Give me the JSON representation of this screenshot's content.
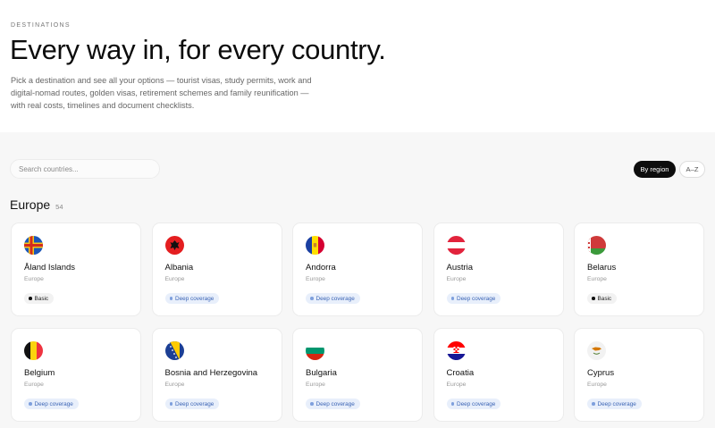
{
  "hero": {
    "eyebrow": "DESTINATIONS",
    "title": "Every way in, for every country.",
    "lead": "Pick a destination and see all your options — tourist visas, study permits, work and digital-nomad routes, golden visas, retirement schemes and family reunification — with real costs, timelines and document checklists."
  },
  "search": {
    "placeholder": "Search countries..."
  },
  "view_toggle": {
    "active_label": "By region",
    "alt_label": "A–Z"
  },
  "region": {
    "name": "Europe",
    "count": "54"
  },
  "badges": {
    "deep": "Deep coverage",
    "basic": "Basic"
  },
  "countries": [
    {
      "name": "Åland Islands",
      "region": "Europe",
      "badge": "Basic",
      "flag": "aland-flag-icon"
    },
    {
      "name": "Albania",
      "region": "Europe",
      "badge": "Deep coverage",
      "flag": "albania-flag-icon"
    },
    {
      "name": "Andorra",
      "region": "Europe",
      "badge": "Deep coverage",
      "flag": "andorra-flag-icon"
    },
    {
      "name": "Austria",
      "region": "Europe",
      "badge": "Deep coverage",
      "flag": "austria-flag-icon"
    },
    {
      "name": "Belarus",
      "region": "Europe",
      "badge": "Basic",
      "flag": "belarus-flag-icon"
    },
    {
      "name": "Belgium",
      "region": "Europe",
      "badge": "Deep coverage",
      "flag": "belgium-flag-icon"
    },
    {
      "name": "Bosnia and Herzegovina",
      "region": "Europe",
      "badge": "Deep coverage",
      "flag": "bosnia-flag-icon"
    },
    {
      "name": "Bulgaria",
      "region": "Europe",
      "badge": "Deep coverage",
      "flag": "bulgaria-flag-icon"
    },
    {
      "name": "Croatia",
      "region": "Europe",
      "badge": "Deep coverage",
      "flag": "croatia-flag-icon"
    },
    {
      "name": "Cyprus",
      "region": "Europe",
      "badge": "Deep coverage",
      "flag": "cyprus-flag-icon"
    }
  ],
  "colors": {
    "accent_dark": "#0d0d0d",
    "deep_badge_bg": "#e8effb",
    "deep_badge_text": "#3b64b5",
    "page_bg": "#f7f7f7"
  }
}
